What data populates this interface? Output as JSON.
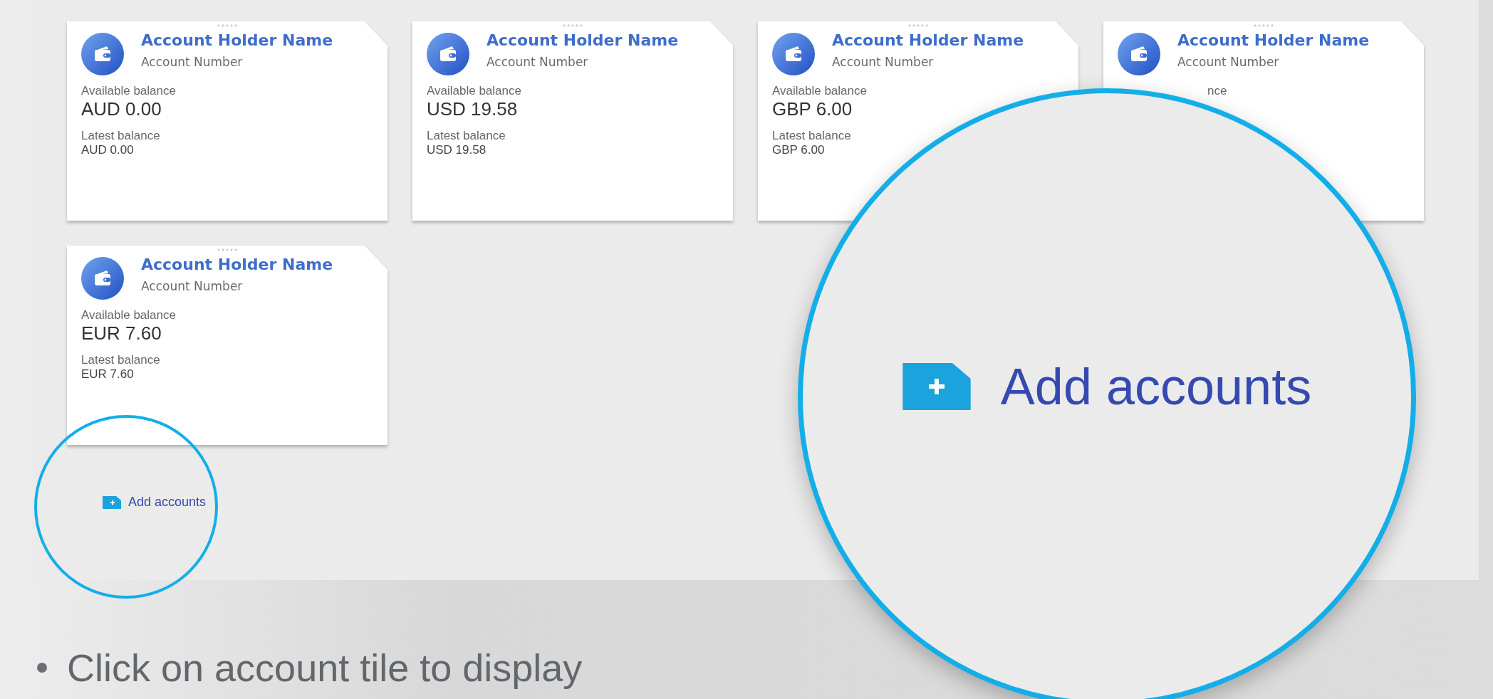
{
  "accounts": [
    {
      "kind": "full",
      "holder": "Account Holder Name",
      "number": "Account Number",
      "available_label": "Available balance",
      "available": "AUD 0.00",
      "latest_label": "Latest balance",
      "latest": "AUD 0.00"
    },
    {
      "kind": "full",
      "holder": "Account Holder Name",
      "number": "Account Number",
      "available_label": "Available balance",
      "available": "USD 19.58",
      "latest_label": "Latest balance",
      "latest": "USD 19.58"
    },
    {
      "kind": "full",
      "holder": "Account Holder Name",
      "number": "Account Number",
      "available_label": "Available balance",
      "available": "GBP 6.00",
      "latest_label": "Latest balance",
      "latest": "GBP 6.00"
    },
    {
      "kind": "covered",
      "holder": "Account Holder Name",
      "number": "Account Number",
      "available_label": "nce"
    },
    {
      "kind": "full",
      "holder": "Account Holder Name",
      "number": "Account Number",
      "available_label": "Available balance",
      "available": "EUR 7.60",
      "latest_label": "Latest balance",
      "latest": "EUR 7.60"
    }
  ],
  "add_accounts": "Add accounts",
  "magnifier": {
    "label": "Add accounts"
  },
  "bullet": "Click on account tile to display"
}
